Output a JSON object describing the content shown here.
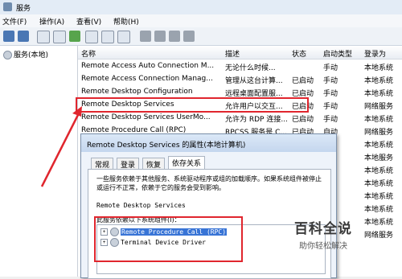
{
  "window": {
    "title": "服务"
  },
  "menu": [
    "文件(F)",
    "操作(A)",
    "查看(V)",
    "帮助(H)"
  ],
  "left_pane": {
    "node": "服务(本地)"
  },
  "columns": [
    "名称",
    "描述",
    "状态",
    "启动类型",
    "登录为"
  ],
  "rows": [
    [
      "Remote Access Auto Connection M...",
      "无论什么时候...",
      "",
      "手动",
      "本地系统"
    ],
    [
      "Remote Access Connection Manag...",
      "管理从这台计算...",
      "已启动",
      "手动",
      "本地系统"
    ],
    [
      "Remote Desktop Configuration",
      "远程桌面配置服...",
      "已启动",
      "手动",
      "本地系统"
    ],
    [
      "Remote Desktop Services",
      "允许用户以交互...",
      "已启动",
      "手动",
      "网络服务"
    ],
    [
      "Remote Desktop Services UserMo...",
      "允许为 RDP 连接...",
      "已启动",
      "手动",
      "本地系统"
    ],
    [
      "Remote Procedure Call (RPC)",
      "RPCSS 服务是 C...",
      "已启动",
      "自动",
      "网络服务"
    ],
    [
      "",
      "",
      "",
      "",
      "本地系统"
    ],
    [
      "",
      "",
      "",
      "",
      "本地服务"
    ],
    [
      "",
      "",
      "",
      "",
      "本地系统"
    ],
    [
      "",
      "",
      "",
      "",
      "本地系统"
    ],
    [
      "",
      "",
      "",
      "",
      "本地系统"
    ],
    [
      "",
      "",
      "",
      "",
      "本地系统"
    ],
    [
      "",
      "",
      "",
      "",
      "本地系统"
    ],
    [
      "",
      "",
      "",
      "",
      "网络服务"
    ]
  ],
  "dialog": {
    "title": "Remote Desktop Services 的属性(本地计算机)",
    "tabs": [
      "常规",
      "登录",
      "恢复",
      "依存关系"
    ],
    "description": "一些服务依赖于其他服务、系统驱动程序或组的加载顺序。如果系统组件被停止或运行不正常，依赖于它的服务会受到影响。",
    "service_name": "Remote Desktop Services",
    "depends_label": "此服务依赖以下系统组件(I)：",
    "tree": [
      "Remote Procedure Call (RPC)",
      "Terminal Device Driver"
    ]
  },
  "watermark": {
    "brand": "百科全说",
    "tagline": "助你轻松解决"
  },
  "colors": {
    "highlight": "#e0262e",
    "selection": "#3874d6"
  }
}
